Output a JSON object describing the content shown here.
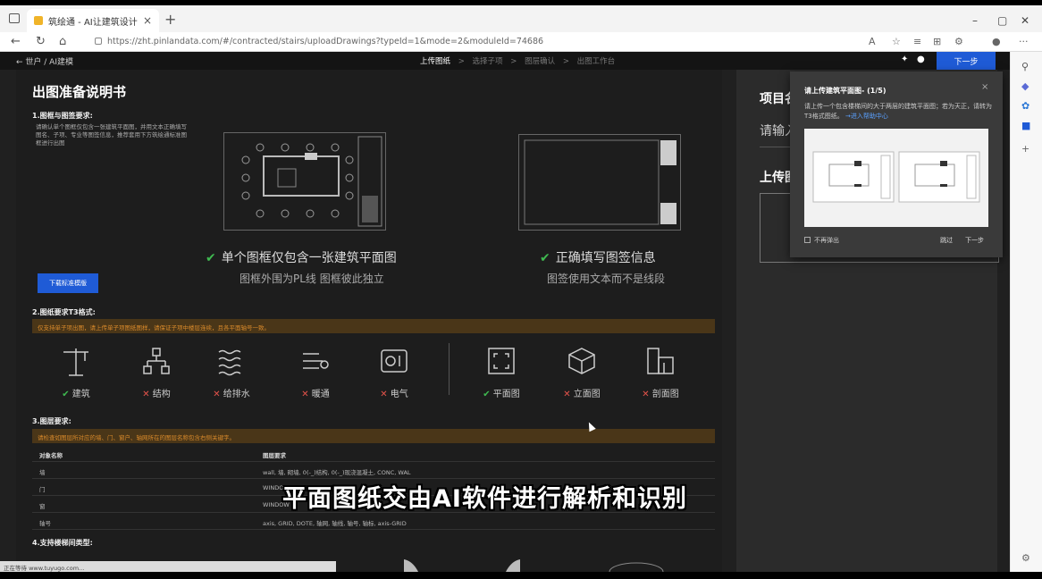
{
  "browser": {
    "tab_title": "筑绘通 - AI让建筑设计更简单",
    "tab_close": "×",
    "new_tab": "+",
    "url": "https://zht.pinlandata.com/#/contracted/stairs/uploadDrawings?typeId=1&mode=2&moduleId=74686",
    "win_min": "–",
    "win_max": "▢",
    "win_close": "✕",
    "more": "···"
  },
  "app": {
    "breadcrumb": "← 世户 / AI建模",
    "steps": [
      "上传图纸",
      "选择子项",
      "图层确认",
      "出图工作台"
    ],
    "step_sep": ">",
    "next_label": "下一步"
  },
  "doc": {
    "title": "出图准备说明书",
    "s1_heading": "1.图框与图签要求:",
    "s1_text": "请确认单个图框仅包含一张建筑平面图，并用文本正确填写图名、子项、专业等图签信息，推荐套用下方筑绘通标准图框进行出图",
    "download_label": "下载标准模版",
    "frame1_caption": "单个图框仅包含一张建筑平面图",
    "frame1_sub": "图框外围为PL线 图框彼此独立",
    "frame2_caption": "正确填写图签信息",
    "frame2_sub": "图签使用文本而不是线段",
    "check": "✔",
    "s2_heading": "2.图纸要求T3格式:",
    "s2_warn": "仅支持单子项出图，请上传单子项图纸图样，请保证子项中楼层连续，且各平面轴号一致。",
    "disciplines": [
      {
        "label": "建筑",
        "ok": true,
        "icon": "crane-icon"
      },
      {
        "label": "结构",
        "ok": false,
        "icon": "structure-icon"
      },
      {
        "label": "给排水",
        "ok": false,
        "icon": "water-icon"
      },
      {
        "label": "暖通",
        "ok": false,
        "icon": "hvac-icon"
      },
      {
        "label": "电气",
        "ok": false,
        "icon": "electric-icon"
      },
      {
        "label": "平面图",
        "ok": true,
        "icon": "plan-icon"
      },
      {
        "label": "立面图",
        "ok": false,
        "icon": "elevation-icon"
      },
      {
        "label": "剖面图",
        "ok": false,
        "icon": "section-icon"
      }
    ],
    "s3_heading": "3.图层要求:",
    "s3_warn": "请检查如图层所对应的墙、门、窗户、轴网所在的图层名称包含右侧关键字。",
    "table_headers": [
      "对象名称",
      "图层要求"
    ],
    "table_rows": [
      [
        "墙",
        "wall, 墙, 砌墙, 0(-_)结构, 0(-_)现浇混凝土, CONC, WAL"
      ],
      [
        "门",
        "WINDOW"
      ],
      [
        "窗",
        "WINDOW"
      ],
      [
        "轴号",
        "axis, GRID, DOTE, 轴网, 轴线, 轴号, 轴标, axis-GRID"
      ]
    ],
    "s4_heading": "4.支持楼梯间类型:"
  },
  "right_panel": {
    "title": "项目名",
    "input": "请输入",
    "upload": "上传图"
  },
  "popover": {
    "title": "请上传建筑平面图- (1/5)",
    "close": "×",
    "desc": "请上传一个包含楼梯间的大于两层的建筑平面图；若为天正，请转为T3格式图纸。",
    "link": "→进入帮助中心",
    "dont_show": "不再弹出",
    "skip": "跳过",
    "next": "下一步"
  },
  "overlay": {
    "subtitle": "平面图纸交由AI软件进行解析和识别",
    "status": "正在等待 www.tuyugo.com..."
  },
  "colors": {
    "accent": "#1f5bd6",
    "ok": "#3fb950",
    "error": "#e5534b",
    "warning_bg": "#4a3618",
    "warning_text": "#d98a2b"
  }
}
